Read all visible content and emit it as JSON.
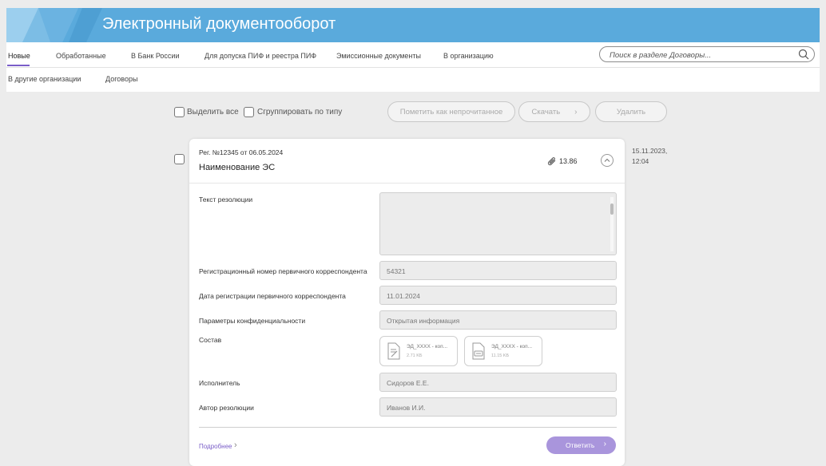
{
  "app": {
    "title": "Электронный документооборот",
    "header_color": "#5aaadc"
  },
  "nav": {
    "tabs": [
      {
        "label": "Новые",
        "active": true
      },
      {
        "label": "Обработанные"
      },
      {
        "label": "В Банк России"
      },
      {
        "label": "Для допуска ПИФ и реестра ПИФ"
      },
      {
        "label": "Эмиссионные документы"
      },
      {
        "label": "В организацию"
      },
      {
        "label": "В другие организации"
      },
      {
        "label": "Договоры"
      }
    ],
    "search": {
      "placeholder": "Поиск в разделе Договоры...",
      "icon": "search-icon"
    },
    "accent_color": "#7a5ec8"
  },
  "toolbar": {
    "select_all": "Выделить все",
    "group_by_type": "Сгруппировать по типу",
    "mark_unread": "Пометить как непрочитанное",
    "download": "Скачать",
    "delete": "Удалить"
  },
  "document": {
    "reg_line": "Рег. №12345 от 06.05.2024",
    "name": "Наименование ЭС",
    "attachments_size": "13.86",
    "date": "15.11.2023, 12:04",
    "fields": {
      "resolution_text_label": "Текст резолюции",
      "resolution_text_value": "",
      "primary_reg_number_label": "Регистрационный номер первичного корреспондента",
      "primary_reg_number_value": "54321",
      "primary_reg_date_label": "Дата регистрации первичного корреспондента",
      "primary_reg_date_value": "11.01.2024",
      "confidentiality_label": "Параметры конфиденциальности",
      "confidentiality_value": "Открытая информация",
      "composition_label": "Состав",
      "executor_label": "Исполнитель",
      "executor_value": "Сидоров Е.Е.",
      "resolution_author_label": "Автор резолюции",
      "resolution_author_value": "Иванов И.И."
    },
    "files": [
      {
        "name": "ЭД_XXXX - коп...",
        "size": "2.71 KБ",
        "icon": "signed-document-icon"
      },
      {
        "name": "ЭД_XXXX - коп...",
        "size": "11.15 KБ",
        "icon": "document-archive-icon"
      }
    ],
    "more_link": "Подробнее",
    "reply_button": "Ответить",
    "reply_color": "#a995dc"
  }
}
